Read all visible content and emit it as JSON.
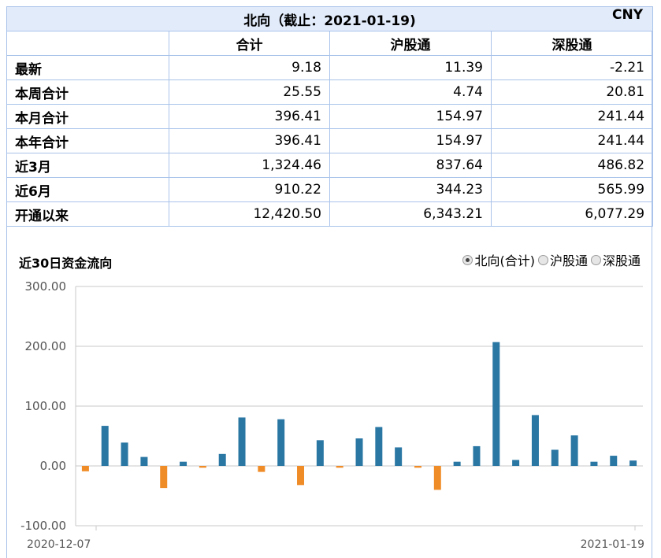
{
  "header": {
    "title": "北向（截止：2021-01-19)",
    "currency": "CNY"
  },
  "columns": [
    "合计",
    "沪股通",
    "深股通"
  ],
  "rows": [
    {
      "label": "最新",
      "values": [
        "9.18",
        "11.39",
        "-2.21"
      ]
    },
    {
      "label": "本周合计",
      "values": [
        "25.55",
        "4.74",
        "20.81"
      ]
    },
    {
      "label": "本月合计",
      "values": [
        "396.41",
        "154.97",
        "241.44"
      ]
    },
    {
      "label": "本年合计",
      "values": [
        "396.41",
        "154.97",
        "241.44"
      ]
    },
    {
      "label": "近3月",
      "values": [
        "1,324.46",
        "837.64",
        "486.82"
      ]
    },
    {
      "label": "近6月",
      "values": [
        "910.22",
        "344.23",
        "565.99"
      ]
    },
    {
      "label": "开通以来",
      "values": [
        "12,420.50",
        "6,343.21",
        "6,077.29"
      ]
    }
  ],
  "chart_section": {
    "title": "近30日资金流向",
    "options": [
      "北向(合计)",
      "沪股通",
      "深股通"
    ],
    "selected": "北向(合计)"
  },
  "chart_data": {
    "type": "bar",
    "title": "",
    "ylim": [
      -100,
      300
    ],
    "yticks": [
      "300.00",
      "200.00",
      "100.00",
      "0.00",
      "-100.00"
    ],
    "x_start_label": "2020-12-07",
    "x_end_label": "2021-01-19",
    "positive_color": "#2a77a4",
    "negative_color": "#f08c28",
    "values": [
      -9,
      67,
      39,
      15,
      -37,
      7,
      -3,
      20,
      81,
      -10,
      78,
      -32,
      43,
      -3,
      46,
      65,
      31,
      -3,
      -40,
      7,
      33,
      207,
      10,
      85,
      27,
      51,
      7,
      17,
      9
    ]
  }
}
